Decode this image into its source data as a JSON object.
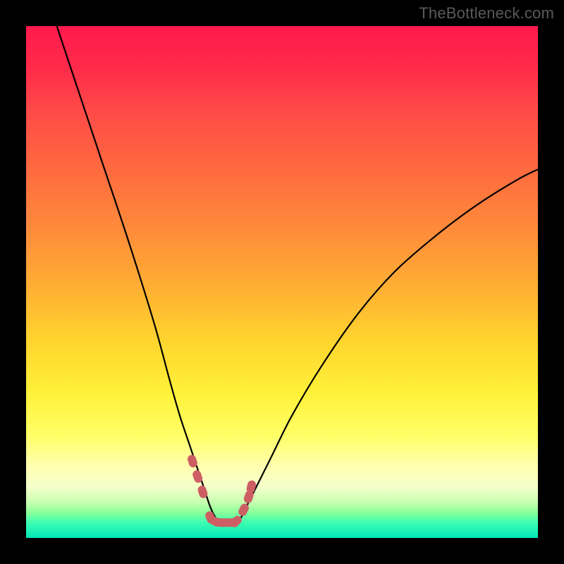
{
  "watermark": "TheBottleneck.com",
  "chart_data": {
    "type": "line",
    "title": "",
    "xlabel": "",
    "ylabel": "",
    "xlim": [
      0,
      100
    ],
    "ylim": [
      0,
      100
    ],
    "series": [
      {
        "name": "bottleneck-curve",
        "x": [
          6,
          10,
          15,
          20,
          25,
          28,
          30,
          32,
          34,
          35,
          36,
          37,
          38,
          39,
          40,
          41,
          42,
          43,
          45,
          48,
          52,
          58,
          65,
          72,
          80,
          88,
          96,
          100
        ],
        "y": [
          100,
          88,
          73,
          58,
          42,
          31,
          24,
          18,
          12,
          9,
          6,
          4,
          3,
          3,
          3,
          3,
          4,
          6,
          10,
          16,
          24,
          34,
          44,
          52,
          59,
          65,
          70,
          72
        ]
      },
      {
        "name": "highlight-marks",
        "x": [
          32.5,
          33.5,
          34.5,
          36,
          37,
          38,
          39,
          40,
          41,
          42.5,
          43.5,
          44
        ],
        "y": [
          15,
          12,
          9,
          4,
          3.2,
          3,
          3,
          3,
          3.2,
          5.5,
          8,
          10
        ]
      }
    ],
    "colors": {
      "curve": "#000000",
      "highlight": "#cd5f64"
    }
  }
}
